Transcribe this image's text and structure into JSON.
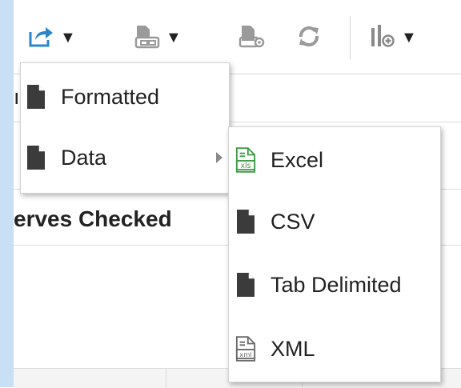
{
  "background": {
    "cut_text": "ı",
    "heading_partial": "erves Checked"
  },
  "menu_export": {
    "items": [
      {
        "label": "Formatted",
        "icon": "document-icon"
      },
      {
        "label": "Data",
        "icon": "document-icon",
        "has_submenu": true
      }
    ]
  },
  "menu_data": {
    "items": [
      {
        "label": "Excel",
        "icon": "excel-xls-icon"
      },
      {
        "label": "CSV",
        "icon": "document-icon"
      },
      {
        "label": "Tab Delimited",
        "icon": "document-icon"
      },
      {
        "label": "XML",
        "icon": "xml-file-icon"
      }
    ]
  },
  "toolbar": {
    "buttons": [
      {
        "icon": "export-icon",
        "has_dropdown": true
      },
      {
        "icon": "print-icon",
        "has_dropdown": true
      },
      {
        "icon": "page-settings-icon"
      },
      {
        "icon": "refresh-icon"
      },
      {
        "icon": "add-chart-icon",
        "has_dropdown": true
      }
    ]
  },
  "colors": {
    "accent_blue": "#2a86c9",
    "icon_gray": "#5a5a5a",
    "icon_light_gray": "#9a9a9a",
    "excel_green": "#3e9b46",
    "side_strip": "#c9dff3"
  }
}
